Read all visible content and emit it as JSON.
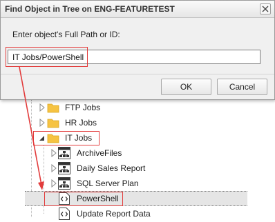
{
  "dialog": {
    "title": "Find Object in Tree on ENG-FEATURETEST",
    "prompt": "Enter object's Full Path or ID:",
    "input_value": "IT Jobs/PowerShell",
    "ok_label": "OK",
    "cancel_label": "Cancel"
  },
  "tree": {
    "items": [
      {
        "label": "FTP Jobs",
        "icon": "folder-icon",
        "expander": "collapsed"
      },
      {
        "label": "HR Jobs",
        "icon": "folder-icon",
        "expander": "collapsed"
      },
      {
        "label": "IT Jobs",
        "icon": "folder-icon",
        "expander": "expanded"
      },
      {
        "label": "ArchiveFiles",
        "icon": "plan-icon",
        "expander": "collapsed"
      },
      {
        "label": "Daily Sales Report",
        "icon": "plan-icon",
        "expander": "collapsed"
      },
      {
        "label": "SQL Server Plan",
        "icon": "plan-icon",
        "expander": "collapsed"
      },
      {
        "label": "PowerShell",
        "icon": "script-icon",
        "expander": "none",
        "selected": true
      },
      {
        "label": "Update Report Data",
        "icon": "script-icon",
        "expander": "none"
      }
    ]
  },
  "colors": {
    "highlight_red": "#e23b3b",
    "folder_yellow": "#f6c342",
    "selection_gray": "#e5e5e5"
  }
}
